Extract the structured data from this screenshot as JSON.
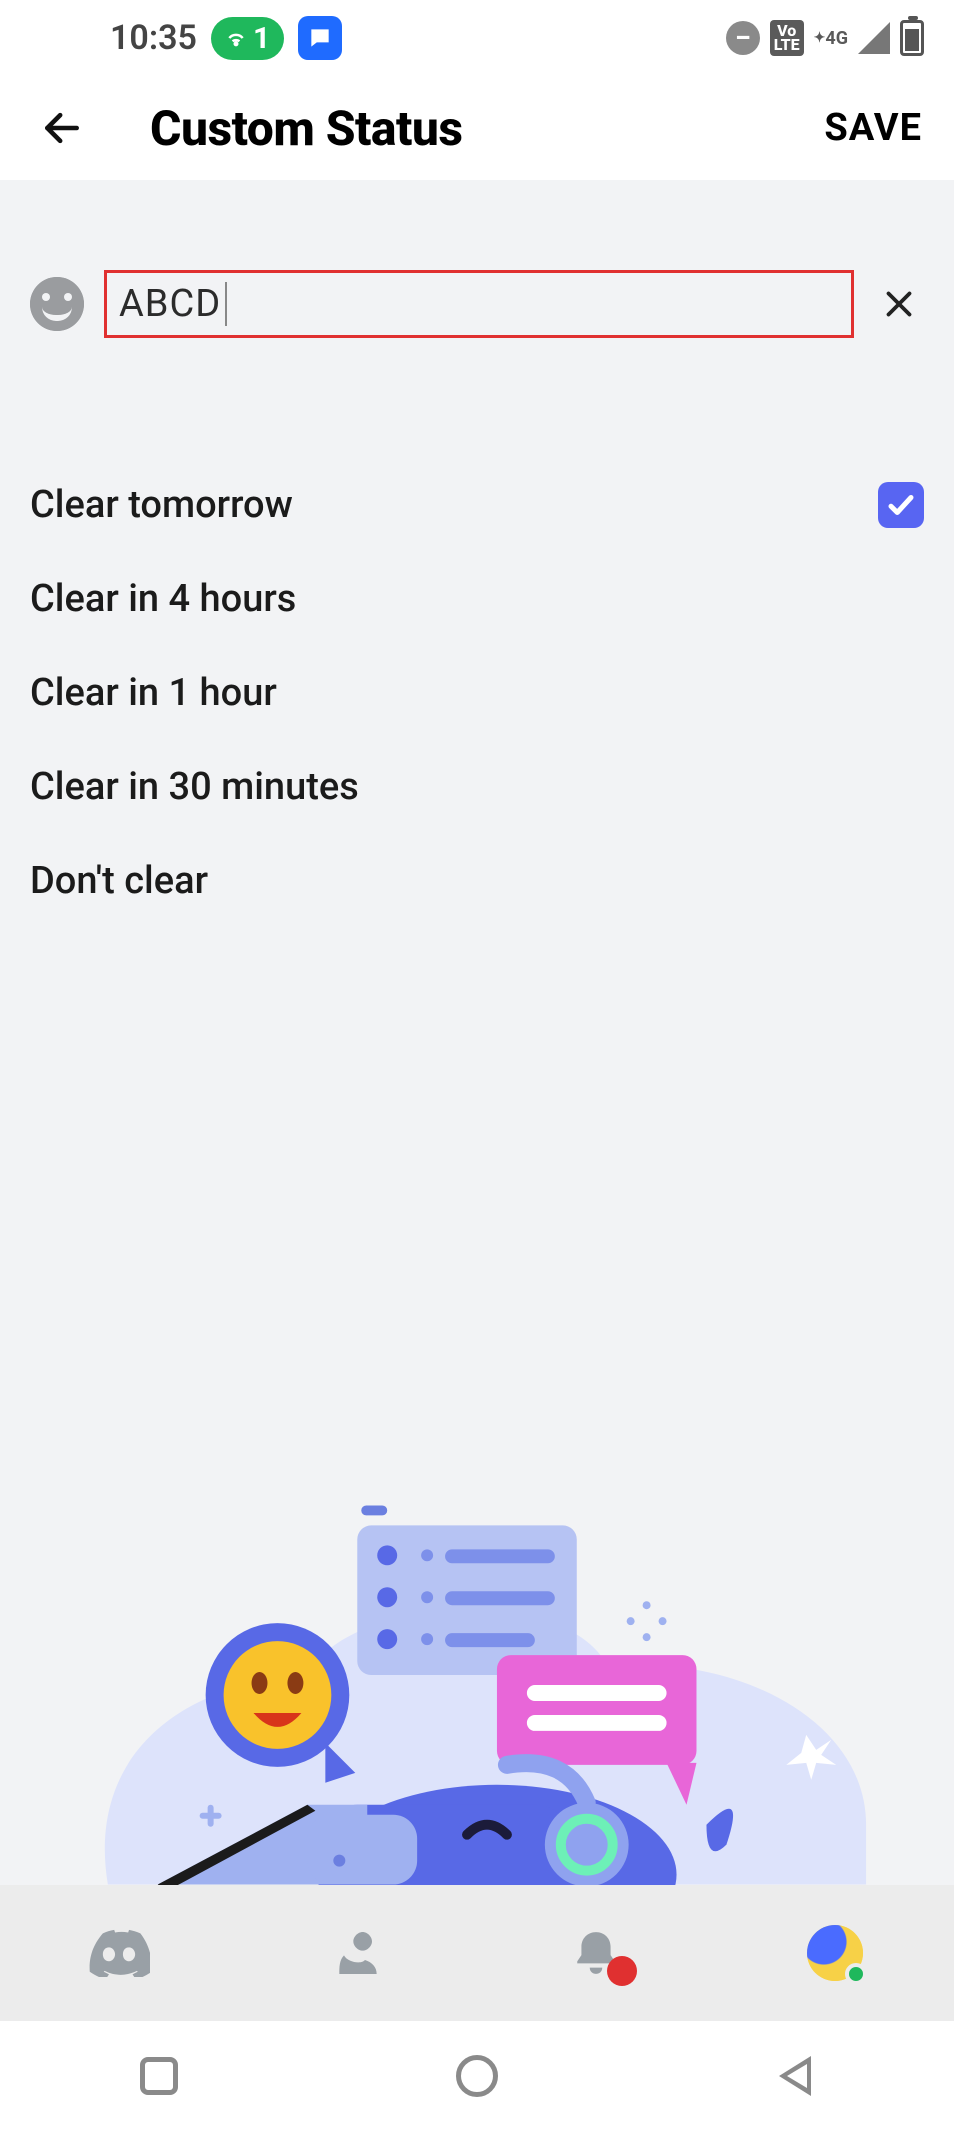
{
  "statusbar": {
    "time": "10:35",
    "notif_count": "1",
    "network_label": "4G",
    "lte_label_top": "Vo",
    "lte_label_bottom": "LTE"
  },
  "header": {
    "title": "Custom Status",
    "save_label": "SAVE"
  },
  "status_input": {
    "value": "ABCD"
  },
  "clear_options": [
    {
      "label": "Clear tomorrow",
      "selected": true
    },
    {
      "label": "Clear in 4 hours",
      "selected": false
    },
    {
      "label": "Clear in 1 hour",
      "selected": false
    },
    {
      "label": "Clear in 30 minutes",
      "selected": false
    },
    {
      "label": "Don't clear",
      "selected": false
    }
  ]
}
